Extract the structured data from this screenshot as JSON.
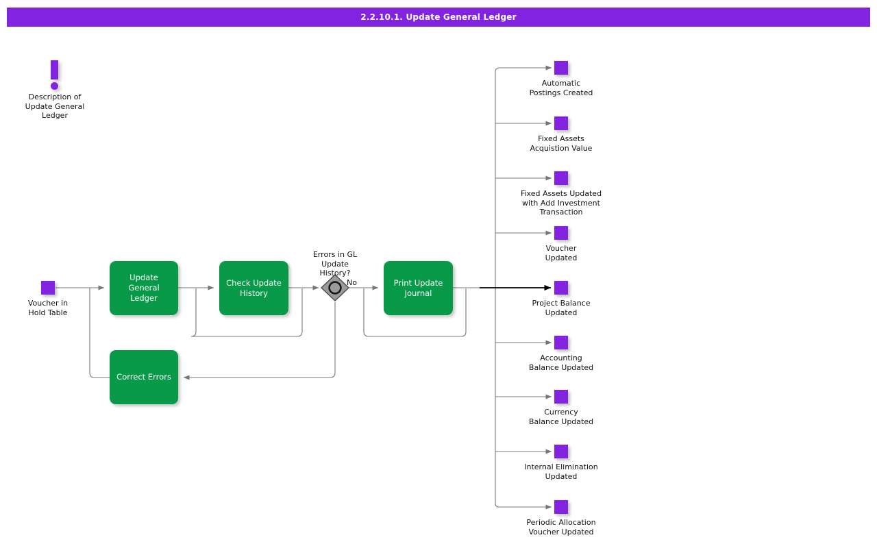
{
  "header": {
    "title": "2.2.10.1. Update General Ledger",
    "bg_color": "#8223e0",
    "text_color": "#ffffff"
  },
  "theme": {
    "task_color": "#089949",
    "task_text_color": "#ffffff",
    "event_color": "#8223e0",
    "gateway_fill": "#9b9b9b",
    "gateway_stroke": "#555555",
    "connector_color": "#777777",
    "main_flow_color": "#000000",
    "canvas_bg": "#ffffff"
  },
  "diagram": {
    "type": "bpmn-process-flow",
    "description_marker": {
      "icon": "exclamation-icon",
      "label": "Description of\nUpdate General\nLedger"
    },
    "start_event": {
      "icon": "event-square-icon",
      "label": "Voucher in\nHold Table"
    },
    "tasks": [
      {
        "id": "update-general-ledger",
        "label": "Update General\nLedger",
        "has_loop_marker": true
      },
      {
        "id": "check-update-history",
        "label": "Check Update\nHistory",
        "has_loop_marker": true
      },
      {
        "id": "print-update-journal",
        "label": "Print Update\nJournal",
        "has_loop_marker": true
      },
      {
        "id": "correct-errors",
        "label": "Correct Errors",
        "has_loop_marker": false
      }
    ],
    "gateway": {
      "id": "errors-in-gl-update-history",
      "label": "Errors in GL\nUpdate\nHistory?",
      "type": "inclusive",
      "outgoing_label": "No"
    },
    "end_events": [
      {
        "id": "automatic-postings-created",
        "label": "Automatic\nPostings Created",
        "emphasis": false
      },
      {
        "id": "fixed-assets-acquistion-value",
        "label": "Fixed Assets\nAcquistion Value",
        "emphasis": false
      },
      {
        "id": "fixed-assets-updated-add-investment",
        "label": "Fixed Assets Updated\nwith Add Investment\nTransaction",
        "emphasis": false
      },
      {
        "id": "voucher-updated",
        "label": "Voucher\nUpdated",
        "emphasis": false
      },
      {
        "id": "project-balance-updated",
        "label": "Project Balance\nUpdated",
        "emphasis": true
      },
      {
        "id": "accounting-balance-updated",
        "label": "Accounting\nBalance Updated",
        "emphasis": false
      },
      {
        "id": "currency-balance-updated",
        "label": "Currency\nBalance Updated",
        "emphasis": false
      },
      {
        "id": "internal-elimination-updated",
        "label": "Internal Elimination\nUpdated",
        "emphasis": false
      },
      {
        "id": "periodic-allocation-voucher-updated",
        "label": "Periodic Allocation\nVoucher Updated",
        "emphasis": false
      }
    ]
  }
}
